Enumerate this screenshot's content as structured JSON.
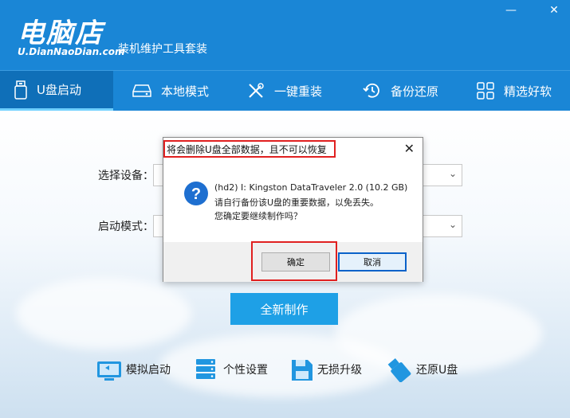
{
  "app": {
    "logo_main": "电脑店",
    "logo_sub": "U.DianNaoDian.com",
    "tagline": "装机维护工具套装",
    "minimize": "—",
    "close": "✕"
  },
  "nav": {
    "items": [
      {
        "label": "U盘启动",
        "icon": "usb-drive-icon",
        "active": true
      },
      {
        "label": "本地模式",
        "icon": "hard-disk-icon",
        "active": false
      },
      {
        "label": "一键重装",
        "icon": "tools-icon",
        "active": false
      },
      {
        "label": "备份还原",
        "icon": "restore-clock-icon",
        "active": false
      },
      {
        "label": "精选好软",
        "icon": "app-grid-icon",
        "active": false
      }
    ]
  },
  "form": {
    "device_label": "选择设备：",
    "mode_label": "启动模式：",
    "create_button": "全新制作"
  },
  "tools": [
    {
      "label": "模拟启动",
      "icon": "monitor-simulate-icon"
    },
    {
      "label": "个性设置",
      "icon": "server-settings-icon"
    },
    {
      "label": "无损升级",
      "icon": "floppy-upgrade-icon"
    },
    {
      "label": "还原U盘",
      "icon": "usb-restore-icon"
    }
  ],
  "dialog": {
    "title": "将会删除U盘全部数据，且不可以恢复",
    "close": "✕",
    "icon": "question-icon",
    "line1": "(hd2) I: Kingston DataTraveler 2.0 (10.2 GB)",
    "line2": "请自行备份该U盘的重要数据，以免丢失。",
    "line3": "您确定要继续制作吗？",
    "ok": "确定",
    "cancel": "取消"
  },
  "colors": {
    "header": "#1a86d6",
    "nav_active": "#0f6fb8",
    "primary": "#1ea0e6",
    "highlight": "#e02020"
  }
}
